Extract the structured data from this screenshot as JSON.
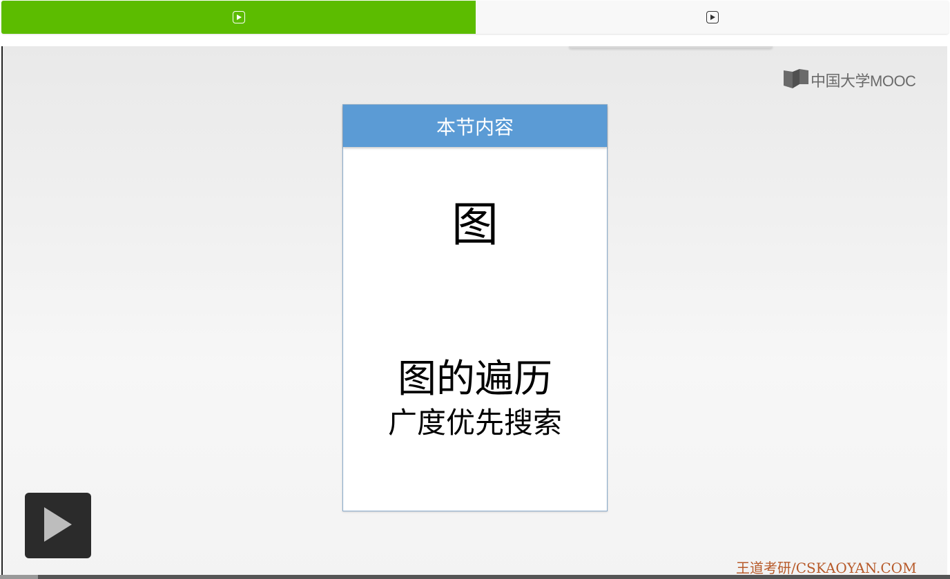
{
  "tabs": [
    {
      "icon": "play-square-icon",
      "active": true
    },
    {
      "icon": "play-square-icon",
      "active": false
    }
  ],
  "colors": {
    "active_tab": "#5cbc00",
    "card_header": "#5b9bd5",
    "watermark": "#b75a2a"
  },
  "logo": {
    "text": "中国大学MOOC"
  },
  "slide": {
    "header": "本节内容",
    "big_title": "图",
    "line1": "图的遍历",
    "line2": "广度优先搜索"
  },
  "watermark": "王道考研/CSKAOYAN.COM",
  "player": {
    "play_icon": "play-icon",
    "progress": 0.04
  }
}
